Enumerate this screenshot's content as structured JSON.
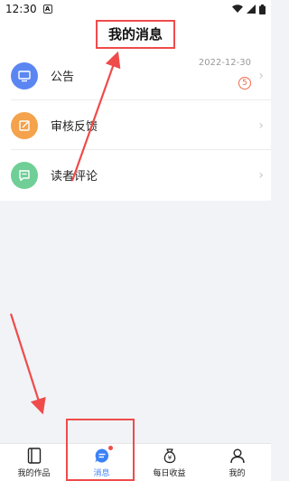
{
  "status_bar": {
    "time": "12:30",
    "app_icon_letter": "A"
  },
  "header": {
    "title": "我的消息"
  },
  "messages": [
    {
      "label": "公告",
      "date": "2022-12-30",
      "badge": "5",
      "icon": "monitor-icon",
      "color": "#5b86f2"
    },
    {
      "label": "审核反馈",
      "icon": "edit-icon",
      "color": "#f4a24b"
    },
    {
      "label": "读者评论",
      "icon": "comment-icon",
      "color": "#6fcf97"
    }
  ],
  "bottom_nav": [
    {
      "label": "我的作品",
      "icon": "book-icon"
    },
    {
      "label": "消息",
      "icon": "message-icon",
      "active": true
    },
    {
      "label": "每日收益",
      "icon": "money-bag-icon"
    },
    {
      "label": "我的",
      "icon": "person-icon"
    }
  ],
  "colors": {
    "accent": "#3b82f6",
    "annotation": "#ef4b4b"
  }
}
